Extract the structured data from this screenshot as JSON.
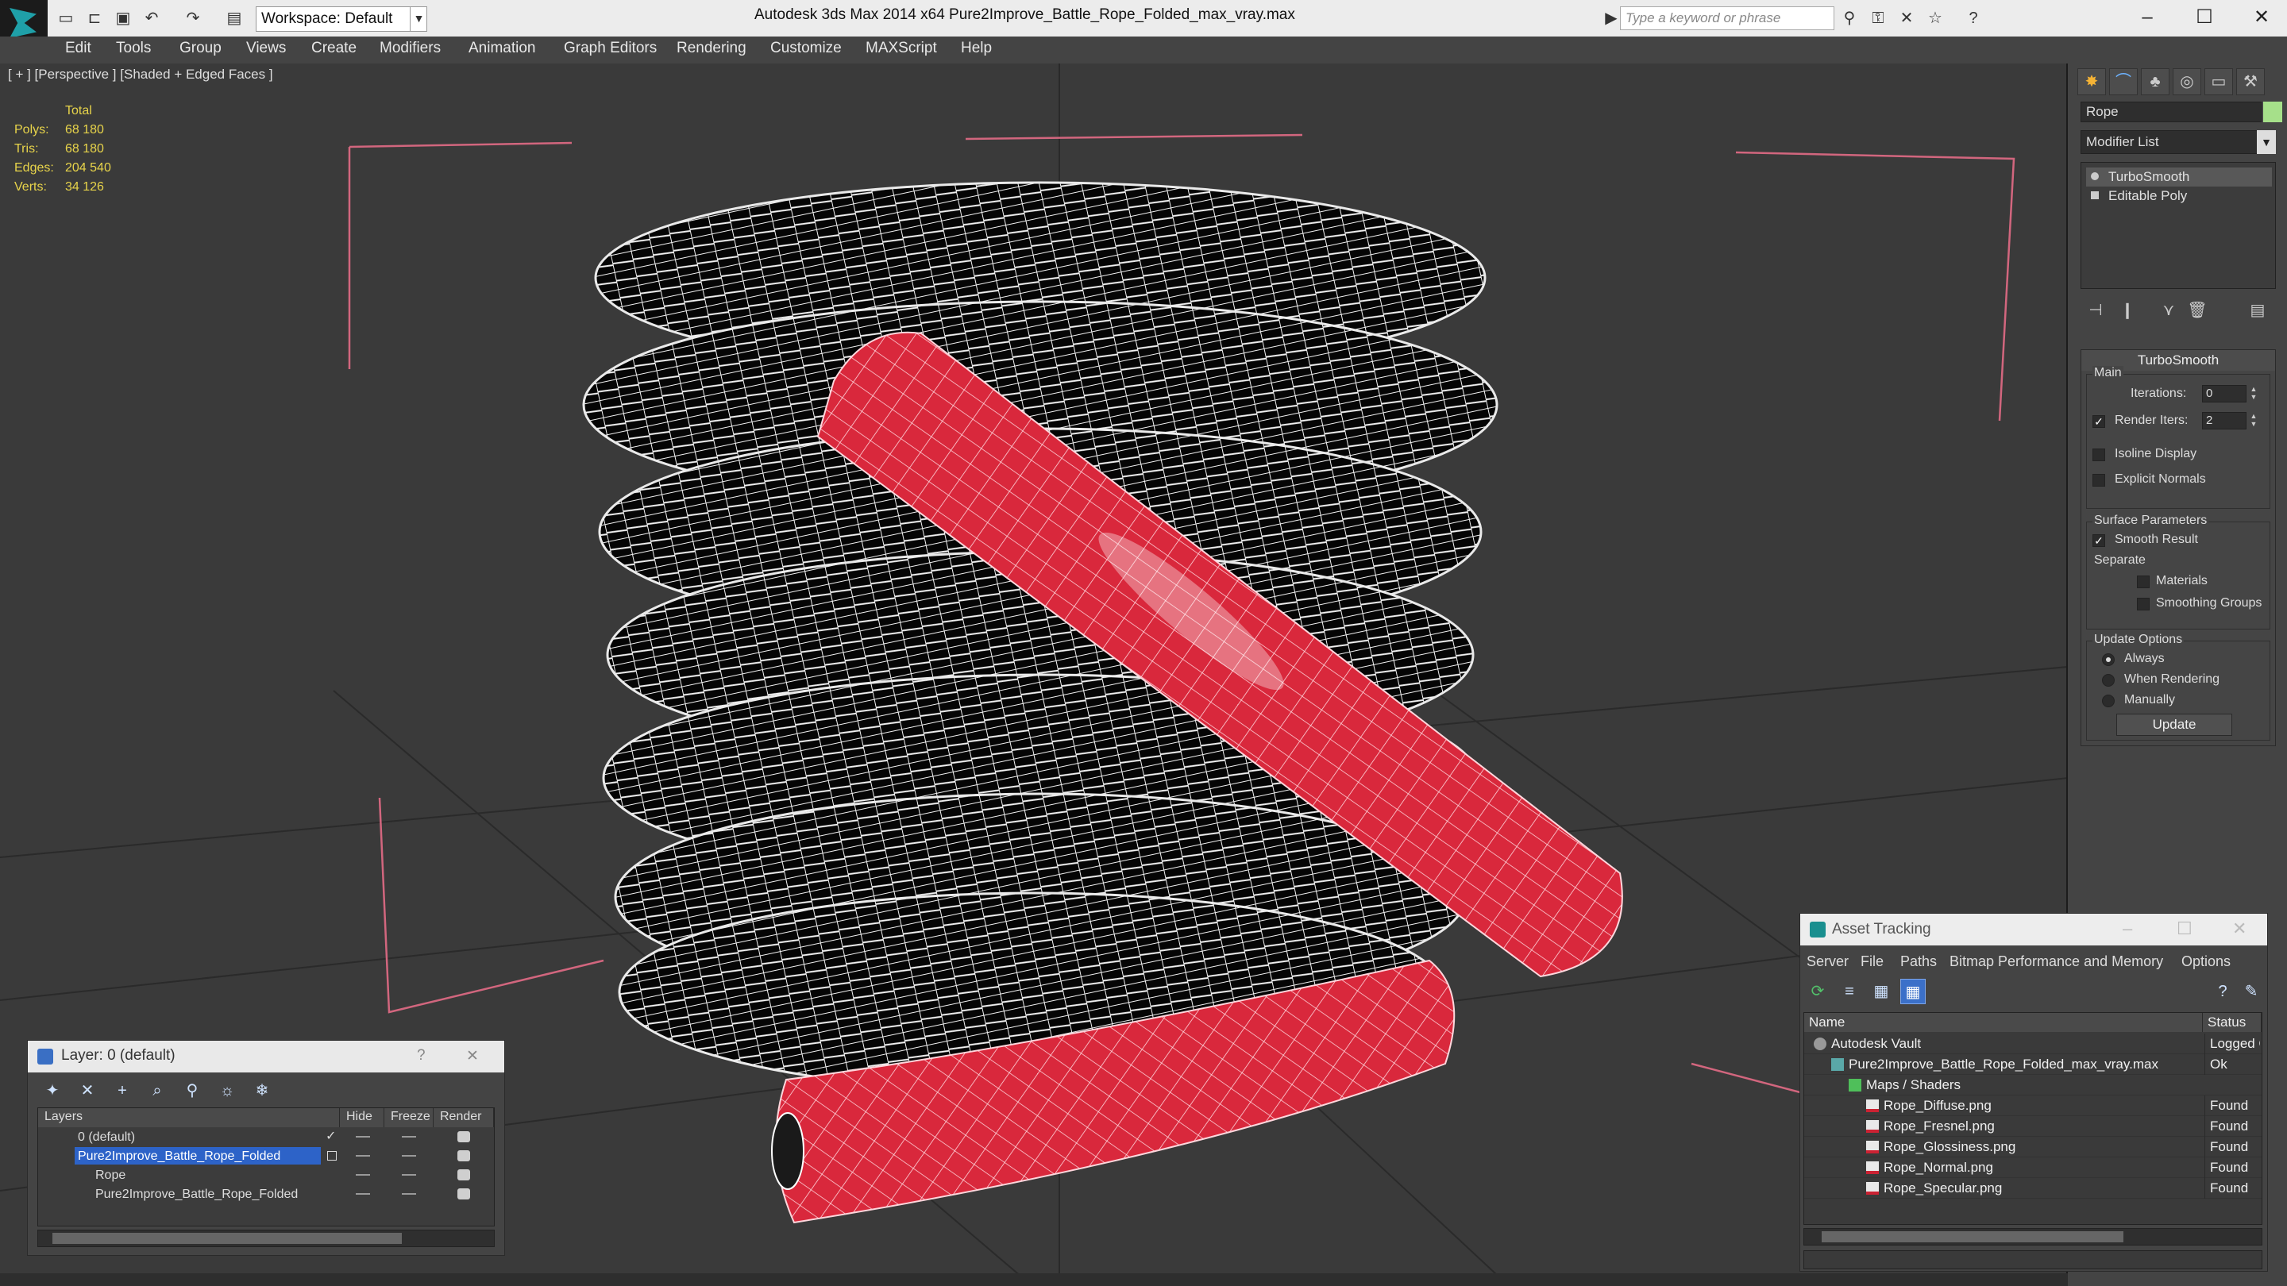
{
  "title_bar": {
    "app_title": "Autodesk 3ds Max  2014 x64      Pure2Improve_Battle_Rope_Folded_max_vray.max",
    "workspace": "Workspace: Default",
    "search_placeholder": "Type a keyword or phrase",
    "quick_access_icons": [
      "new-icon",
      "open-icon",
      "save-icon",
      "undo-icon",
      "redo-icon",
      "project-icon"
    ],
    "window_controls": [
      "minimize",
      "maximize",
      "close"
    ]
  },
  "menu": [
    "Edit",
    "Tools",
    "Group",
    "Views",
    "Create",
    "Modifiers",
    "Animation",
    "Graph Editors",
    "Rendering",
    "Customize",
    "MAXScript",
    "Help"
  ],
  "viewport": {
    "label": "[ + ] [Perspective ] [Shaded + Edged Faces ]",
    "stats": {
      "header": "Total",
      "rows": [
        {
          "label": "Polys:",
          "value": "68 180"
        },
        {
          "label": "Tris:",
          "value": "68 180"
        },
        {
          "label": "Edges:",
          "value": "204 540"
        },
        {
          "label": "Verts:",
          "value": "34 126"
        }
      ]
    },
    "colors": {
      "background": "#3a3a3a",
      "grid": "#2a2a2a",
      "wireframe": "#ffffff",
      "rope_red": "#d9283c",
      "selection_bracket": "#d2667e"
    }
  },
  "command_panel": {
    "tabs": [
      "create-icon",
      "modify-icon",
      "hierarchy-icon",
      "motion-icon",
      "display-icon",
      "utilities-icon"
    ],
    "object_name": "Rope",
    "object_color": "#a6e08a",
    "modifier_list": "Modifier List",
    "stack": [
      {
        "label": "TurboSmooth",
        "selected": true
      },
      {
        "label": "Editable Poly",
        "selected": false
      }
    ],
    "turbosmooth": {
      "title": "TurboSmooth",
      "main_label": "Main",
      "iterations_label": "Iterations:",
      "iterations_value": "0",
      "render_iters_label": "Render Iters:",
      "render_iters_value": "2",
      "render_iters_checked": true,
      "isoline_label": "Isoline Display",
      "explicit_normals_label": "Explicit Normals",
      "surface_params_label": "Surface Parameters",
      "smooth_result_label": "Smooth Result",
      "smooth_result_checked": true,
      "separate_label": "Separate",
      "materials_label": "Materials",
      "smoothing_groups_label": "Smoothing Groups",
      "update_options_label": "Update Options",
      "always_label": "Always",
      "when_rendering_label": "When Rendering",
      "manually_label": "Manually",
      "update_option_selected": "Always",
      "update_button": "Update"
    }
  },
  "layer_dialog": {
    "title": "Layer: 0 (default)",
    "help": "?",
    "close": "✕",
    "columns": [
      "Layers",
      "Hide",
      "Freeze",
      "Render"
    ],
    "rows": [
      {
        "name": "0 (default)",
        "indent": 1,
        "selected": false,
        "current": true
      },
      {
        "name": "Pure2Improve_Battle_Rope_Folded",
        "indent": 1,
        "selected": true,
        "current": false
      },
      {
        "name": "Rope",
        "indent": 2,
        "selected": false,
        "current": false
      },
      {
        "name": "Pure2Improve_Battle_Rope_Folded",
        "indent": 2,
        "selected": false,
        "current": false
      }
    ]
  },
  "asset_tracking": {
    "title": "Asset Tracking",
    "menu": [
      "Server",
      "File",
      "Paths",
      "Bitmap Performance and Memory",
      "Options"
    ],
    "columns": [
      "Name",
      "Status"
    ],
    "rows": [
      {
        "name": "Autodesk Vault",
        "status": "Logged Out",
        "indent": 0,
        "icon": "vault-icon"
      },
      {
        "name": "Pure2Improve_Battle_Rope_Folded_max_vray.max",
        "status": "Ok",
        "indent": 1,
        "icon": "max-file-icon"
      },
      {
        "name": "Maps / Shaders",
        "status": "",
        "indent": 2,
        "icon": "maps-icon"
      },
      {
        "name": "Rope_Diffuse.png",
        "status": "Found",
        "indent": 3,
        "icon": "png-icon"
      },
      {
        "name": "Rope_Fresnel.png",
        "status": "Found",
        "indent": 3,
        "icon": "png-icon"
      },
      {
        "name": "Rope_Glossiness.png",
        "status": "Found",
        "indent": 3,
        "icon": "png-icon"
      },
      {
        "name": "Rope_Normal.png",
        "status": "Found",
        "indent": 3,
        "icon": "png-icon"
      },
      {
        "name": "Rope_Specular.png",
        "status": "Found",
        "indent": 3,
        "icon": "png-icon"
      }
    ]
  }
}
